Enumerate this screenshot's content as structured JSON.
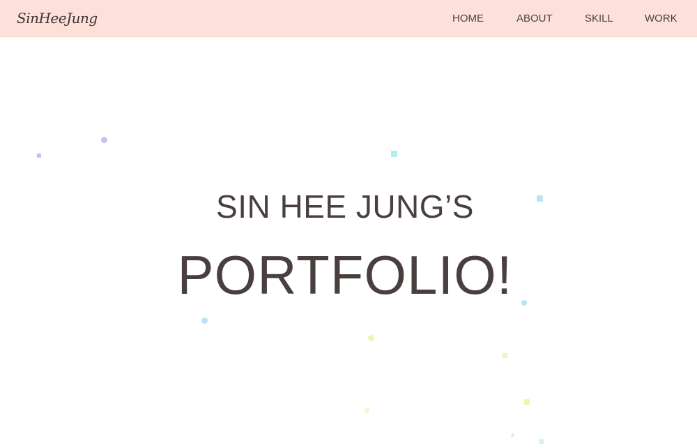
{
  "navbar": {
    "logo_text": "SinHeeJung",
    "items": [
      {
        "label": "HOME"
      },
      {
        "label": "ABOUT"
      },
      {
        "label": "SKILL"
      },
      {
        "label": "WORK"
      }
    ],
    "background_color": "#fde0d9"
  },
  "hero": {
    "subtitle": "SIN HEE JUNG’S",
    "title": "PORTFOLIO!",
    "text_color": "#4a3f3f"
  },
  "particle_colors": [
    "#c9c0f2",
    "#b3ecf2",
    "#b9e4f8",
    "#eef5b0"
  ]
}
